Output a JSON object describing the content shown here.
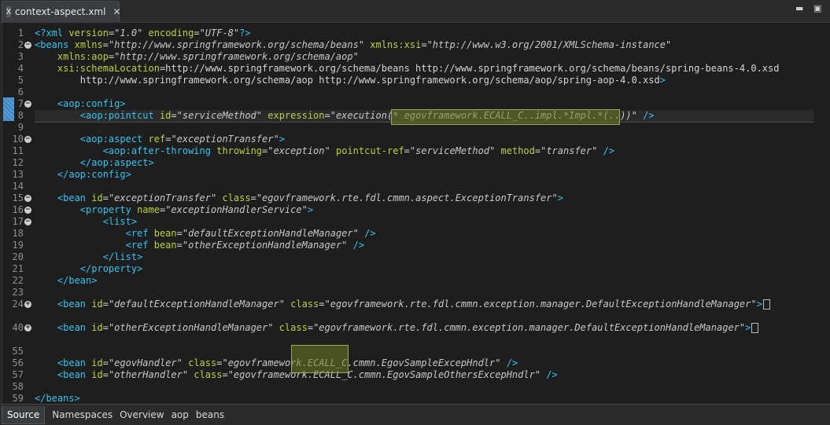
{
  "tab": {
    "title": "context-aspect.xml",
    "close": "✕",
    "file_icon": "X"
  },
  "window": {
    "minimize": "▬",
    "maximize": "▣"
  },
  "lines": [
    {
      "n": "1",
      "t": "<?xml version=\"1.0\" encoding=\"UTF-8\"?>"
    },
    {
      "n": "2",
      "t": "<beans xmlns=\"http://www.springframework.org/schema/beans\" xmlns:xsi=\"http://www.w3.org/2001/XMLSchema-instance\"",
      "f": "-"
    },
    {
      "n": "3",
      "t": "    xmlns:aop=\"http://www.springframework.org/schema/aop\""
    },
    {
      "n": "4",
      "t": "    xsi:schemaLocation=\"http://www.springframework.org/schema/beans http://www.springframework.org/schema/beans/spring-beans-4.0.xsd"
    },
    {
      "n": "5",
      "t": "        http://www.springframework.org/schema/aop http://www.springframework.org/schema/aop/spring-aop-4.0.xsd\">"
    },
    {
      "n": "6",
      "t": ""
    },
    {
      "n": "7",
      "t": "    <aop:config>",
      "f": "-"
    },
    {
      "n": "8",
      "t": "        <aop:pointcut id=\"serviceMethod\" expression=\"execution(* egovframework.ECALL_C..impl.*Impl.*(..))\" />"
    },
    {
      "n": "9",
      "t": ""
    },
    {
      "n": "10",
      "t": "        <aop:aspect ref=\"exceptionTransfer\">",
      "f": "-"
    },
    {
      "n": "11",
      "t": "            <aop:after-throwing throwing=\"exception\" pointcut-ref=\"serviceMethod\" method=\"transfer\" />"
    },
    {
      "n": "12",
      "t": "        </aop:aspect>"
    },
    {
      "n": "13",
      "t": "    </aop:config>"
    },
    {
      "n": "14",
      "t": ""
    },
    {
      "n": "15",
      "t": "    <bean id=\"exceptionTransfer\" class=\"egovframework.rte.fdl.cmmn.aspect.ExceptionTransfer\">",
      "f": "-"
    },
    {
      "n": "16",
      "t": "        <property name=\"exceptionHandlerService\">",
      "f": "-"
    },
    {
      "n": "17",
      "t": "            <list>",
      "f": "-"
    },
    {
      "n": "18",
      "t": "                <ref bean=\"defaultExceptionHandleManager\" />"
    },
    {
      "n": "19",
      "t": "                <ref bean=\"otherExceptionHandleManager\" />"
    },
    {
      "n": "20",
      "t": "            </list>"
    },
    {
      "n": "21",
      "t": "        </property>"
    },
    {
      "n": "22",
      "t": "    </bean>"
    },
    {
      "n": "23",
      "t": ""
    },
    {
      "n": "24",
      "t": "    <bean id=\"defaultExceptionHandleManager\" class=\"egovframework.rte.fdl.cmmn.exception.manager.DefaultExceptionHandleManager\">",
      "f": "+",
      "box": true
    },
    {
      "n": "",
      "t": ""
    },
    {
      "n": "40",
      "t": "    <bean id=\"otherExceptionHandleManager\" class=\"egovframework.rte.fdl.cmmn.exception.manager.DefaultExceptionHandleManager\">",
      "f": "+",
      "box": true
    },
    {
      "n": "",
      "t": ""
    },
    {
      "n": "55",
      "t": ""
    },
    {
      "n": "56",
      "t": "    <bean id=\"egovHandler\" class=\"egovframework.ECALL_C.cmmn.EgovSampleExcepHndlr\" />"
    },
    {
      "n": "57",
      "t": "    <bean id=\"otherHandler\" class=\"egovframework.ECALL_C.cmmn.EgovSampleOthersExcepHndlr\" />"
    },
    {
      "n": "58",
      "t": ""
    },
    {
      "n": "59",
      "t": "</beans>"
    }
  ],
  "bottom_tabs": [
    "Source",
    "Namespaces",
    "Overview",
    "aop",
    "beans"
  ]
}
